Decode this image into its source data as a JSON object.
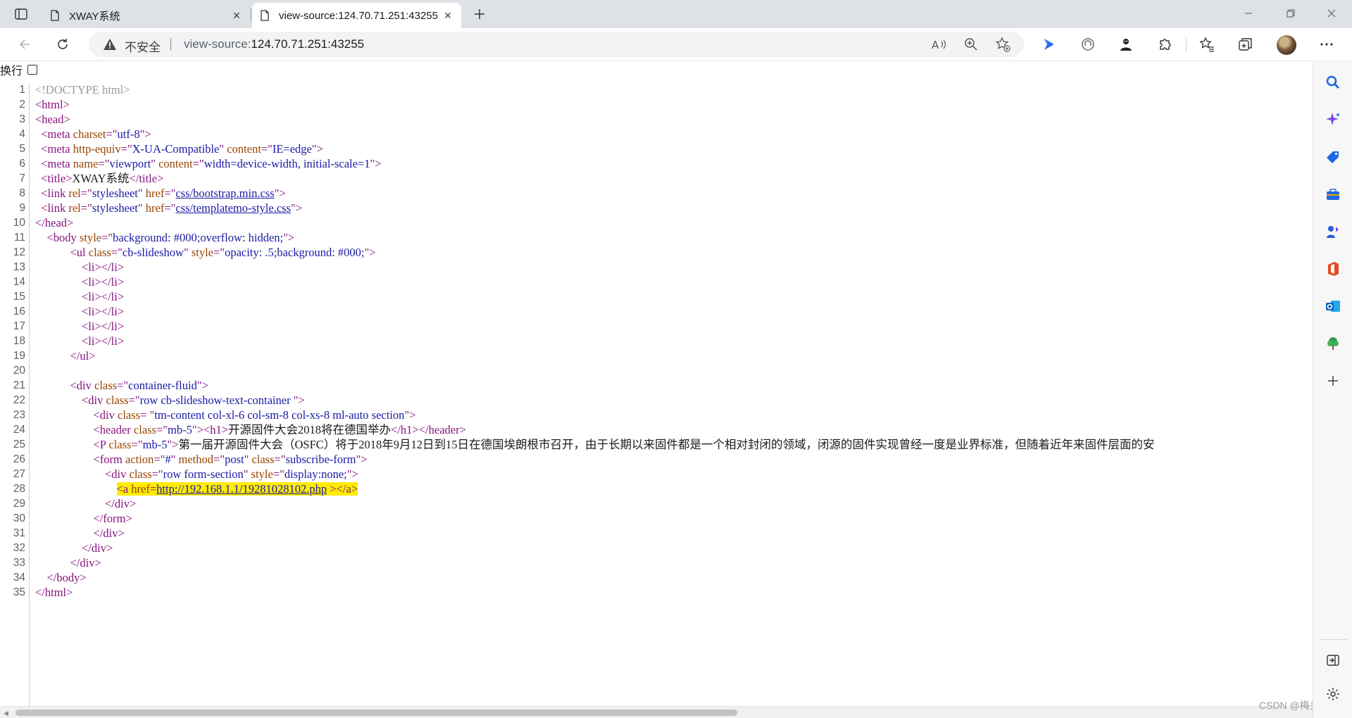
{
  "tabs": [
    {
      "label": "XWAY系统",
      "active": false
    },
    {
      "label": "view-source:124.70.71.251:43255",
      "active": true
    }
  ],
  "address_bar": {
    "security_label": "不安全",
    "url_scheme": "view-source:",
    "url_host": "124.70.71.251:43255"
  },
  "toolbar_icons": [
    "read-aloud-icon",
    "zoom-icon",
    "add-favorite-icon",
    "copilot-icon",
    "tracking-icon",
    "extension-profile-icon",
    "extensions-icon",
    "favorites-icon",
    "collections-icon",
    "profile-avatar",
    "more-icon"
  ],
  "sidebar_icons": [
    "search-icon",
    "copilot-sparkle-icon",
    "shopping-tag-icon",
    "tools-icon",
    "games-icon",
    "office-icon",
    "outlook-icon",
    "tree-icon",
    "add-icon",
    "hide-sidebar-icon",
    "settings-icon"
  ],
  "wrap_label": "换行",
  "source_lines": [
    {
      "n": "1",
      "parts": [
        [
          "doctype",
          "<!DOCTYPE html>"
        ]
      ]
    },
    {
      "n": "2",
      "parts": [
        [
          "tag",
          "<html>"
        ]
      ]
    },
    {
      "n": "3",
      "parts": [
        [
          "tag",
          "<head>"
        ]
      ]
    },
    {
      "n": "4",
      "parts": [
        [
          "txt",
          "  "
        ],
        [
          "tag",
          "<meta "
        ],
        [
          "attr",
          "charset"
        ],
        [
          "tag",
          "=\""
        ],
        [
          "val",
          "utf-8"
        ],
        [
          "tag",
          "\">"
        ]
      ]
    },
    {
      "n": "5",
      "parts": [
        [
          "txt",
          "  "
        ],
        [
          "tag",
          "<meta "
        ],
        [
          "attr",
          "http-equiv"
        ],
        [
          "tag",
          "=\""
        ],
        [
          "val",
          "X-UA-Compatible"
        ],
        [
          "tag",
          "\" "
        ],
        [
          "attr",
          "content"
        ],
        [
          "tag",
          "=\""
        ],
        [
          "val",
          "IE=edge"
        ],
        [
          "tag",
          "\">"
        ]
      ]
    },
    {
      "n": "6",
      "parts": [
        [
          "txt",
          "  "
        ],
        [
          "tag",
          "<meta "
        ],
        [
          "attr",
          "name"
        ],
        [
          "tag",
          "=\""
        ],
        [
          "val",
          "viewport"
        ],
        [
          "tag",
          "\" "
        ],
        [
          "attr",
          "content"
        ],
        [
          "tag",
          "=\""
        ],
        [
          "val",
          "width=device-width, initial-scale=1"
        ],
        [
          "tag",
          "\">"
        ]
      ]
    },
    {
      "n": "7",
      "parts": [
        [
          "txt",
          "  "
        ],
        [
          "tag",
          "<title>"
        ],
        [
          "txt",
          "XWAY系统"
        ],
        [
          "tag",
          "</title>"
        ]
      ]
    },
    {
      "n": "8",
      "parts": [
        [
          "txt",
          "  "
        ],
        [
          "tag",
          "<link "
        ],
        [
          "attr",
          "rel"
        ],
        [
          "tag",
          "=\""
        ],
        [
          "val",
          "stylesheet"
        ],
        [
          "tag",
          "\" "
        ],
        [
          "attr",
          "href"
        ],
        [
          "tag",
          "=\""
        ],
        [
          "lnk",
          "css/bootstrap.min.css"
        ],
        [
          "tag",
          "\">"
        ]
      ]
    },
    {
      "n": "9",
      "parts": [
        [
          "txt",
          "  "
        ],
        [
          "tag",
          "<link "
        ],
        [
          "attr",
          "rel"
        ],
        [
          "tag",
          "=\""
        ],
        [
          "val",
          "stylesheet"
        ],
        [
          "tag",
          "\" "
        ],
        [
          "attr",
          "href"
        ],
        [
          "tag",
          "=\""
        ],
        [
          "lnk",
          "css/templatemo-style.css"
        ],
        [
          "tag",
          "\">"
        ]
      ]
    },
    {
      "n": "10",
      "parts": [
        [
          "tag",
          "</head>"
        ]
      ]
    },
    {
      "n": "11",
      "parts": [
        [
          "txt",
          "    "
        ],
        [
          "tag",
          "<body "
        ],
        [
          "attr",
          "style"
        ],
        [
          "tag",
          "=\""
        ],
        [
          "val",
          "background: #000;overflow: hidden;"
        ],
        [
          "tag",
          "\">"
        ]
      ]
    },
    {
      "n": "12",
      "parts": [
        [
          "txt",
          "            "
        ],
        [
          "tag",
          "<ul "
        ],
        [
          "attr",
          "class"
        ],
        [
          "tag",
          "=\""
        ],
        [
          "val",
          "cb-slideshow"
        ],
        [
          "tag",
          "\" "
        ],
        [
          "attr",
          "style"
        ],
        [
          "tag",
          "=\""
        ],
        [
          "val",
          "opacity: .5;background: #000;"
        ],
        [
          "tag",
          "\">"
        ]
      ]
    },
    {
      "n": "13",
      "parts": [
        [
          "txt",
          "                "
        ],
        [
          "tag",
          "<li></li>"
        ]
      ]
    },
    {
      "n": "14",
      "parts": [
        [
          "txt",
          "                "
        ],
        [
          "tag",
          "<li></li>"
        ]
      ]
    },
    {
      "n": "15",
      "parts": [
        [
          "txt",
          "                "
        ],
        [
          "tag",
          "<li></li>"
        ]
      ]
    },
    {
      "n": "16",
      "parts": [
        [
          "txt",
          "                "
        ],
        [
          "tag",
          "<li></li>"
        ]
      ]
    },
    {
      "n": "17",
      "parts": [
        [
          "txt",
          "                "
        ],
        [
          "tag",
          "<li></li>"
        ]
      ]
    },
    {
      "n": "18",
      "parts": [
        [
          "txt",
          "                "
        ],
        [
          "tag",
          "<li></li>"
        ]
      ]
    },
    {
      "n": "19",
      "parts": [
        [
          "txt",
          "            "
        ],
        [
          "tag",
          "</ul>"
        ]
      ]
    },
    {
      "n": "20",
      "parts": [
        [
          "txt",
          ""
        ]
      ]
    },
    {
      "n": "21",
      "parts": [
        [
          "txt",
          "            "
        ],
        [
          "tag",
          "<div "
        ],
        [
          "attr",
          "class"
        ],
        [
          "tag",
          "=\""
        ],
        [
          "val",
          "container-fluid"
        ],
        [
          "tag",
          "\">"
        ]
      ]
    },
    {
      "n": "22",
      "parts": [
        [
          "txt",
          "                "
        ],
        [
          "tag",
          "<div "
        ],
        [
          "attr",
          "class"
        ],
        [
          "tag",
          "=\""
        ],
        [
          "val",
          "row cb-slideshow-text-container "
        ],
        [
          "tag",
          "\">"
        ]
      ]
    },
    {
      "n": "23",
      "parts": [
        [
          "txt",
          "                    "
        ],
        [
          "tag",
          "<div "
        ],
        [
          "attr",
          "class"
        ],
        [
          "tag",
          "= \""
        ],
        [
          "val",
          "tm-content col-xl-6 col-sm-8 col-xs-8 ml-auto section"
        ],
        [
          "tag",
          "\">"
        ]
      ]
    },
    {
      "n": "24",
      "parts": [
        [
          "txt",
          "                    "
        ],
        [
          "tag",
          "<header "
        ],
        [
          "attr",
          "class"
        ],
        [
          "tag",
          "=\""
        ],
        [
          "val",
          "mb-5"
        ],
        [
          "tag",
          "\"><h1>"
        ],
        [
          "txt",
          "开源固件大会2018将在德国举办"
        ],
        [
          "tag",
          "</h1></header>"
        ]
      ]
    },
    {
      "n": "25",
      "parts": [
        [
          "txt",
          "                    "
        ],
        [
          "tag",
          "<P "
        ],
        [
          "attr",
          "class"
        ],
        [
          "tag",
          "=\""
        ],
        [
          "val",
          "mb-5"
        ],
        [
          "tag",
          "\">"
        ],
        [
          "txt",
          "第一届开源固件大会（OSFC）将于2018年9月12日到15日在德国埃朗根市召开，由于长期以来固件都是一个相对封闭的领域，闭源的固件实现曾经一度是业界标准，但随着近年来固件层面的安"
        ]
      ]
    },
    {
      "n": "26",
      "parts": [
        [
          "txt",
          "                    "
        ],
        [
          "tag",
          "<form "
        ],
        [
          "attr",
          "action"
        ],
        [
          "tag",
          "=\""
        ],
        [
          "val",
          "#"
        ],
        [
          "tag",
          "\" "
        ],
        [
          "attr",
          "method"
        ],
        [
          "tag",
          "=\""
        ],
        [
          "val",
          "post"
        ],
        [
          "tag",
          "\" "
        ],
        [
          "attr",
          "class"
        ],
        [
          "tag",
          "=\""
        ],
        [
          "val",
          "subscribe-form"
        ],
        [
          "tag",
          "\">"
        ]
      ]
    },
    {
      "n": "27",
      "parts": [
        [
          "txt",
          "                        "
        ],
        [
          "tag",
          "<div "
        ],
        [
          "attr",
          "class"
        ],
        [
          "tag",
          "=\""
        ],
        [
          "val",
          "row form-section"
        ],
        [
          "tag",
          "\" "
        ],
        [
          "attr",
          "style"
        ],
        [
          "tag",
          "=\""
        ],
        [
          "val",
          "display:none;"
        ],
        [
          "tag",
          "\">"
        ]
      ]
    },
    {
      "n": "28",
      "highlight": true,
      "parts": [
        [
          "txt",
          "                            "
        ],
        [
          "tag",
          "<a "
        ],
        [
          "attr",
          "href"
        ],
        [
          "tag",
          "="
        ],
        [
          "lnk",
          "http://192.168.1.1/19281028102.php"
        ],
        [
          "tag",
          " ></a>"
        ]
      ]
    },
    {
      "n": "29",
      "parts": [
        [
          "txt",
          "                        "
        ],
        [
          "tag",
          "</div>"
        ]
      ]
    },
    {
      "n": "30",
      "parts": [
        [
          "txt",
          "                    "
        ],
        [
          "tag",
          "</form>"
        ]
      ]
    },
    {
      "n": "31",
      "parts": [
        [
          "txt",
          "                    "
        ],
        [
          "tag",
          "</div>"
        ]
      ]
    },
    {
      "n": "32",
      "parts": [
        [
          "txt",
          "                "
        ],
        [
          "tag",
          "</div>"
        ]
      ]
    },
    {
      "n": "33",
      "parts": [
        [
          "txt",
          "            "
        ],
        [
          "tag",
          "</div>"
        ]
      ]
    },
    {
      "n": "34",
      "parts": [
        [
          "txt",
          "    "
        ],
        [
          "tag",
          "</body>"
        ]
      ]
    },
    {
      "n": "35",
      "parts": [
        [
          "tag",
          "</html>"
        ]
      ]
    }
  ],
  "watermark": "CSDN @梅头脑_",
  "colors": {
    "tag": "#881280",
    "attribute": "#994500",
    "value": "#1a1aa6",
    "highlight": "#ffec00"
  }
}
